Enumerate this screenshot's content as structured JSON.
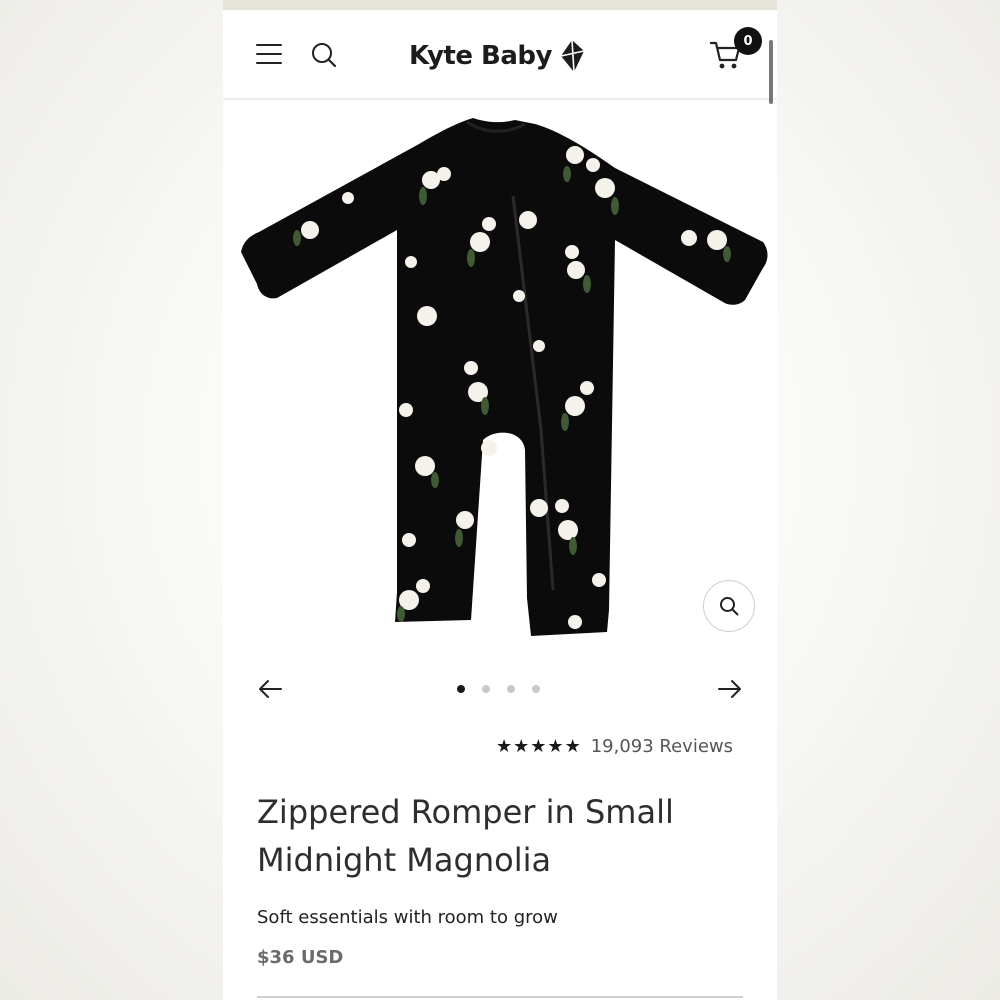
{
  "header": {
    "brand": "Kyte Baby",
    "cart_count": "0"
  },
  "product": {
    "rating_stars": 5,
    "reviews": "19,093 Reviews",
    "title": "Zippered Romper in Small Midnight Magnolia",
    "tagline": "Soft essentials with room to grow",
    "price": "$36 USD"
  },
  "gallery": {
    "slide_count": 4,
    "active_slide": 1
  },
  "icons": {
    "menu": "hamburger-icon",
    "search": "search-icon",
    "logo_mark": "kite-icon",
    "cart": "cart-icon",
    "zoom": "magnify-icon",
    "prev": "arrow-left-icon",
    "next": "arrow-right-icon"
  },
  "colors": {
    "romper": "#0b0b0b",
    "flower": "#f4f2ea",
    "leaf": "#3f5a34",
    "text_dark": "#222222",
    "price_grey": "#6b6b6b"
  }
}
